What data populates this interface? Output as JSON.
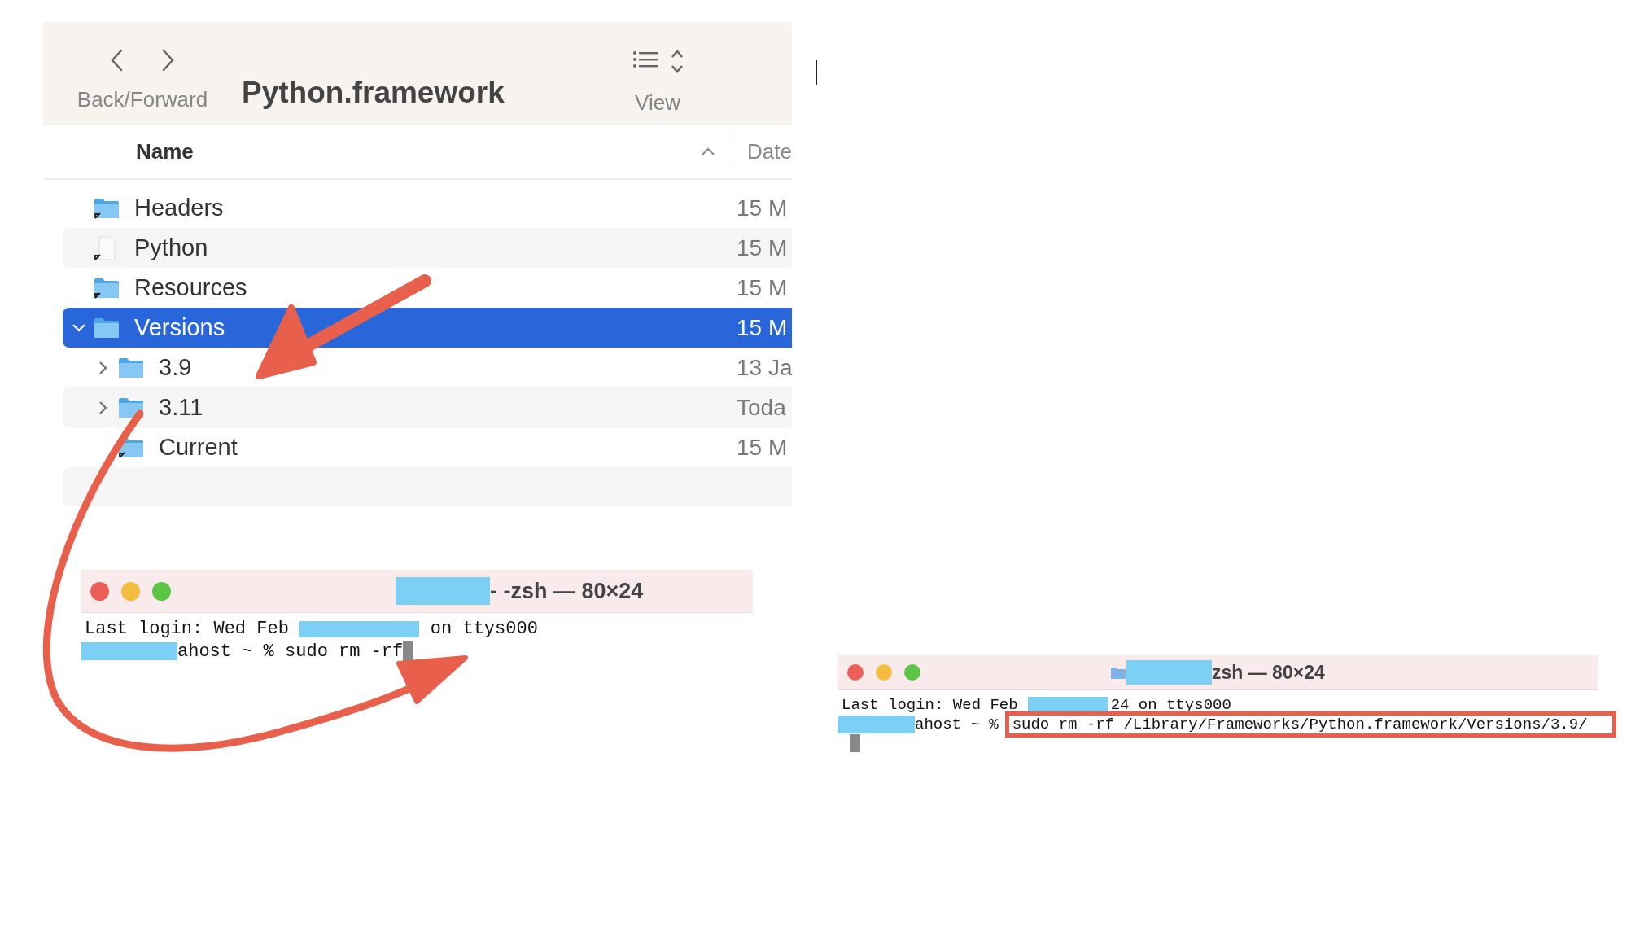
{
  "finder": {
    "title": "Python.framework",
    "nav_label": "Back/Forward",
    "view_label": "View",
    "columns": [
      {
        "label": "Name",
        "sorted": true
      },
      {
        "label": "Date",
        "sorted": false
      }
    ],
    "rows": [
      {
        "name": "Headers",
        "kind": "folder",
        "alias": true,
        "date": "15 M",
        "selected": false
      },
      {
        "name": "Python",
        "kind": "file",
        "alias": true,
        "date": "15 M",
        "selected": false
      },
      {
        "name": "Resources",
        "kind": "folder",
        "alias": true,
        "date": "15 M",
        "selected": false
      },
      {
        "name": "Versions",
        "kind": "folder",
        "alias": false,
        "date": "15 M",
        "selected": true,
        "expanded": true,
        "children": [
          {
            "name": "3.9",
            "kind": "folder",
            "alias": false,
            "date": "13 Ja",
            "selected": false,
            "expanded": false
          },
          {
            "name": "3.11",
            "kind": "folder",
            "alias": false,
            "date": "Toda",
            "selected": false,
            "expanded": false
          },
          {
            "name": "Current",
            "kind": "folder",
            "alias": true,
            "date": "15 M",
            "selected": false
          }
        ]
      }
    ]
  },
  "terminals": [
    {
      "title": "- -zsh — 80×24",
      "folder_icon": false,
      "lines": [
        [
          {
            "kind": "text",
            "text": "Last login: Wed Feb"
          },
          {
            "kind": "redacted"
          },
          {
            "kind": "text",
            "text": "on ttys000"
          }
        ],
        [
          {
            "kind": "redacted"
          },
          {
            "kind": "text",
            "text": "ahost ~ % sudo rm -rf"
          },
          {
            "kind": "cursor"
          }
        ]
      ]
    },
    {
      "title": "zsh — 80×24",
      "folder_icon": true,
      "lines": [
        [
          {
            "kind": "text",
            "text": "Last login: Wed Feb"
          },
          {
            "kind": "redacted"
          },
          {
            "kind": "text",
            "text": "24 on ttys000"
          }
        ],
        [
          {
            "kind": "redacted"
          },
          {
            "kind": "text",
            "text": "ahost ~ %"
          },
          {
            "kind": "highlight",
            "text": "sudo rm -rf /Library/Frameworks/Python.framework/Versions/3.9/"
          }
        ],
        [
          {
            "kind": "cursor"
          }
        ]
      ]
    }
  ]
}
